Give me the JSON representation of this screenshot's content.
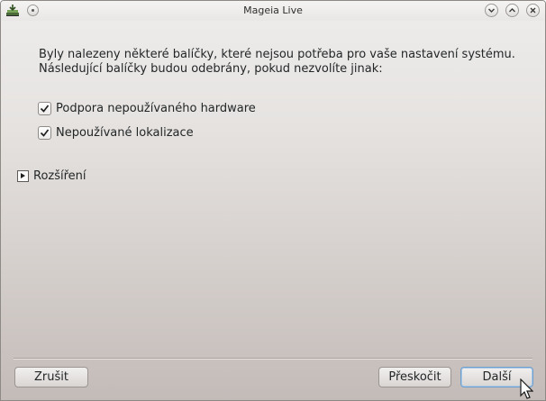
{
  "window": {
    "title": "Mageia Live",
    "icons": {
      "app": "mageia-installer-icon",
      "pin": "pin-icon",
      "minimize": "chevron-down-icon",
      "maximize": "chevron-up-icon",
      "close": "close-icon"
    }
  },
  "message": {
    "line1": "Byly nalezeny některé balíčky, které nejsou potřeba pro vaše nastavení systému.",
    "line2": "Následující balíčky budou odebrány, pokud nezvolíte jinak:"
  },
  "options": [
    {
      "label": "Podpora nepoužívaného hardware",
      "checked": true
    },
    {
      "label": "Nepoužívané lokalizace",
      "checked": true
    }
  ],
  "advanced": {
    "label": "Rozšíření",
    "expanded": false
  },
  "buttons": {
    "cancel": "Zrušit",
    "skip": "Přeskočit",
    "next": "Další"
  },
  "colors": {
    "default_button_border": "#6f9fcf"
  }
}
